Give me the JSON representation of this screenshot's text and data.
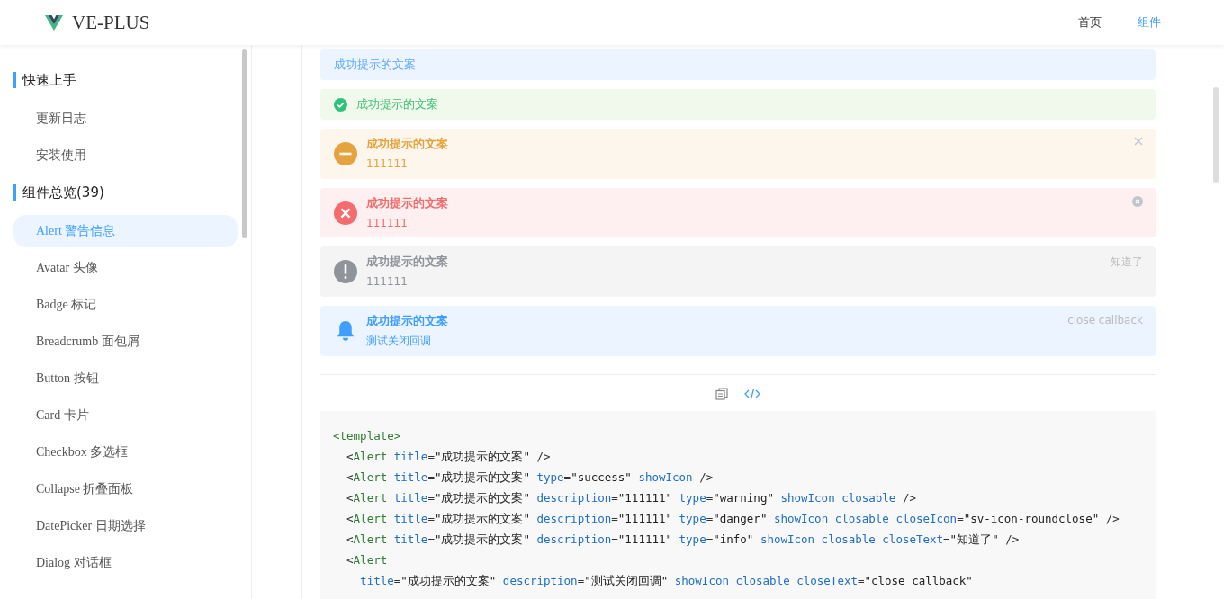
{
  "header": {
    "logo_text": "VE-PLUS",
    "nav": [
      {
        "label": "首页",
        "selected": false
      },
      {
        "label": "组件",
        "selected": true
      }
    ]
  },
  "sidebar": {
    "groups": [
      {
        "title": "快速上手",
        "items": [
          {
            "label": "更新日志",
            "selected": false
          },
          {
            "label": "安装使用",
            "selected": false
          }
        ]
      },
      {
        "title": "组件总览(39)",
        "items": [
          {
            "label": "Alert 警告信息",
            "selected": true
          },
          {
            "label": "Avatar 头像",
            "selected": false
          },
          {
            "label": "Badge 标记",
            "selected": false
          },
          {
            "label": "Breadcrumb 面包屑",
            "selected": false
          },
          {
            "label": "Button 按钮",
            "selected": false
          },
          {
            "label": "Card 卡片",
            "selected": false
          },
          {
            "label": "Checkbox 多选框",
            "selected": false
          },
          {
            "label": "Collapse 折叠面板",
            "selected": false
          },
          {
            "label": "DatePicker 日期选择",
            "selected": false
          },
          {
            "label": "Dialog 对话框",
            "selected": false
          }
        ]
      }
    ]
  },
  "alerts": [
    {
      "kind": "plain",
      "title": "成功提示的文案",
      "show_icon": false
    },
    {
      "kind": "success",
      "title": "成功提示的文案",
      "show_icon": true
    },
    {
      "kind": "warning",
      "title": "成功提示的文案",
      "description": "111111",
      "show_icon": true,
      "close": {
        "kind": "cross"
      }
    },
    {
      "kind": "danger",
      "title": "成功提示的文案",
      "description": "111111",
      "show_icon": true,
      "close": {
        "kind": "roundclose"
      }
    },
    {
      "kind": "info",
      "title": "成功提示的文案",
      "description": "111111",
      "show_icon": true,
      "close": {
        "kind": "text",
        "text": "知道了"
      }
    },
    {
      "kind": "notice",
      "title": "成功提示的文案",
      "description": "测试关闭回调",
      "show_icon": true,
      "close": {
        "kind": "text",
        "text": "close callback"
      }
    }
  ],
  "code_lines": [
    [
      {
        "kind": "tag",
        "text": "<template>"
      }
    ],
    [
      {
        "kind": "punct",
        "text": "  <"
      },
      {
        "kind": "tag",
        "text": "Alert"
      },
      {
        "kind": "attr",
        "text": " title"
      },
      {
        "kind": "punct",
        "text": "="
      },
      {
        "kind": "string",
        "text": "\"成功提示的文案\""
      },
      {
        "kind": "punct",
        "text": " />"
      }
    ],
    [
      {
        "kind": "punct",
        "text": "  <"
      },
      {
        "kind": "tag",
        "text": "Alert"
      },
      {
        "kind": "attr",
        "text": " title"
      },
      {
        "kind": "punct",
        "text": "="
      },
      {
        "kind": "string",
        "text": "\"成功提示的文案\""
      },
      {
        "kind": "attr",
        "text": " type"
      },
      {
        "kind": "punct",
        "text": "="
      },
      {
        "kind": "string",
        "text": "\"success\""
      },
      {
        "kind": "attr",
        "text": " showIcon"
      },
      {
        "kind": "punct",
        "text": " />"
      }
    ],
    [
      {
        "kind": "punct",
        "text": "  <"
      },
      {
        "kind": "tag",
        "text": "Alert"
      },
      {
        "kind": "attr",
        "text": " title"
      },
      {
        "kind": "punct",
        "text": "="
      },
      {
        "kind": "string",
        "text": "\"成功提示的文案\""
      },
      {
        "kind": "attr",
        "text": " description"
      },
      {
        "kind": "punct",
        "text": "="
      },
      {
        "kind": "string",
        "text": "\"111111\""
      },
      {
        "kind": "attr",
        "text": " type"
      },
      {
        "kind": "punct",
        "text": "="
      },
      {
        "kind": "string",
        "text": "\"warning\""
      },
      {
        "kind": "attr",
        "text": " showIcon closable"
      },
      {
        "kind": "punct",
        "text": " />"
      }
    ],
    [
      {
        "kind": "punct",
        "text": "  <"
      },
      {
        "kind": "tag",
        "text": "Alert"
      },
      {
        "kind": "attr",
        "text": " title"
      },
      {
        "kind": "punct",
        "text": "="
      },
      {
        "kind": "string",
        "text": "\"成功提示的文案\""
      },
      {
        "kind": "attr",
        "text": " description"
      },
      {
        "kind": "punct",
        "text": "="
      },
      {
        "kind": "string",
        "text": "\"111111\""
      },
      {
        "kind": "attr",
        "text": " type"
      },
      {
        "kind": "punct",
        "text": "="
      },
      {
        "kind": "string",
        "text": "\"danger\""
      },
      {
        "kind": "attr",
        "text": " showIcon closable closeIcon"
      },
      {
        "kind": "punct",
        "text": "="
      },
      {
        "kind": "string",
        "text": "\"sv-icon-roundclose\""
      },
      {
        "kind": "punct",
        "text": " />"
      }
    ],
    [
      {
        "kind": "punct",
        "text": "  <"
      },
      {
        "kind": "tag",
        "text": "Alert"
      },
      {
        "kind": "attr",
        "text": " title"
      },
      {
        "kind": "punct",
        "text": "="
      },
      {
        "kind": "string",
        "text": "\"成功提示的文案\""
      },
      {
        "kind": "attr",
        "text": " description"
      },
      {
        "kind": "punct",
        "text": "="
      },
      {
        "kind": "string",
        "text": "\"111111\""
      },
      {
        "kind": "attr",
        "text": " type"
      },
      {
        "kind": "punct",
        "text": "="
      },
      {
        "kind": "string",
        "text": "\"info\""
      },
      {
        "kind": "attr",
        "text": " showIcon closable closeText"
      },
      {
        "kind": "punct",
        "text": "="
      },
      {
        "kind": "string",
        "text": "\"知道了\""
      },
      {
        "kind": "punct",
        "text": " />"
      }
    ],
    [
      {
        "kind": "punct",
        "text": "  <"
      },
      {
        "kind": "tag",
        "text": "Alert"
      }
    ],
    [
      {
        "kind": "attr",
        "text": "    title"
      },
      {
        "kind": "punct",
        "text": "="
      },
      {
        "kind": "string",
        "text": "\"成功提示的文案\""
      },
      {
        "kind": "attr",
        "text": " description"
      },
      {
        "kind": "punct",
        "text": "="
      },
      {
        "kind": "string",
        "text": "\"测试关闭回调\""
      },
      {
        "kind": "attr",
        "text": " showIcon closable closeText"
      },
      {
        "kind": "punct",
        "text": "="
      },
      {
        "kind": "string",
        "text": "\"close callback\""
      }
    ]
  ]
}
